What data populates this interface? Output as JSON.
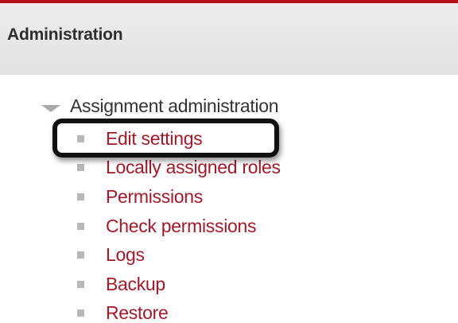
{
  "block": {
    "title": "Administration"
  },
  "tree": {
    "node_label": "Assignment administration",
    "items": [
      {
        "label": "Edit settings"
      },
      {
        "label": "Locally assigned roles"
      },
      {
        "label": "Permissions"
      },
      {
        "label": "Check permissions"
      },
      {
        "label": "Logs"
      },
      {
        "label": "Backup"
      },
      {
        "label": "Restore"
      }
    ]
  },
  "colors": {
    "accent": "#b3121c",
    "link": "#a3192a",
    "header_bg": "#e8e8e8",
    "bullet": "#b8b8b8"
  },
  "icons": {
    "expander": "triangle-down-icon",
    "bullet": "square-bullet-icon"
  }
}
